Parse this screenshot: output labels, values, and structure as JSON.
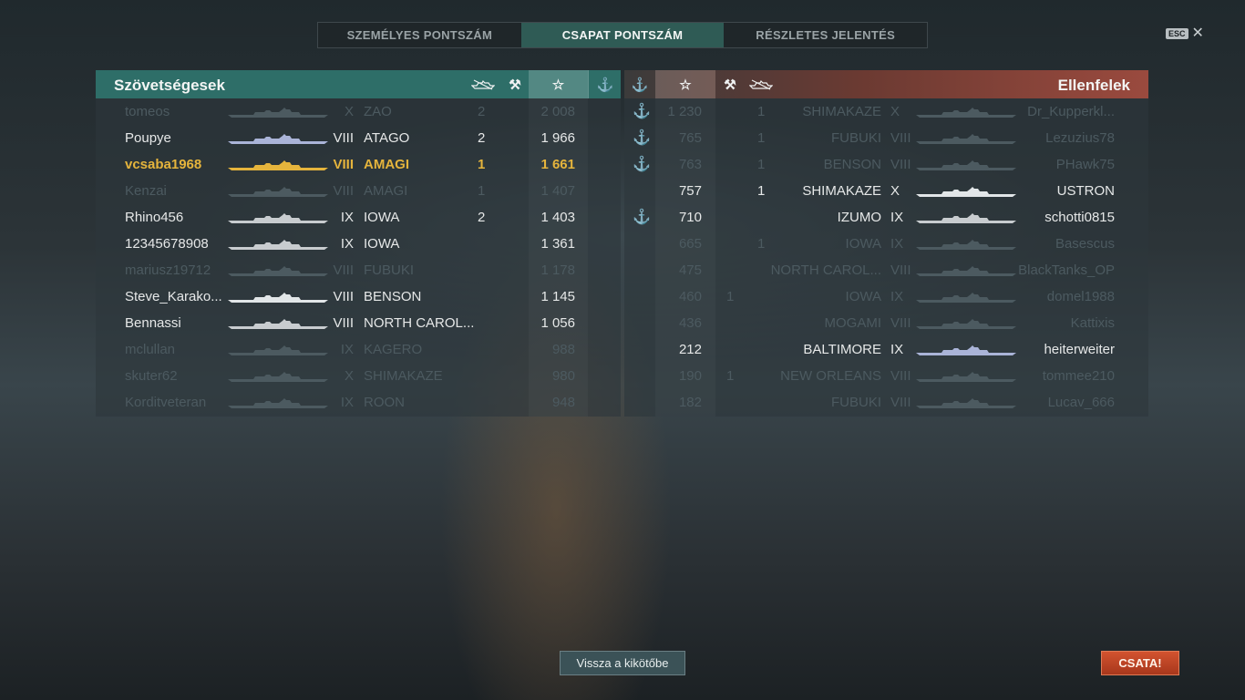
{
  "tabs": [
    "SZEMÉLYES PONTSZÁM",
    "CSAPAT PONTSZÁM",
    "RÉSZLETES JELENTÉS"
  ],
  "active_tab": 1,
  "esc_label": "ESC",
  "left": {
    "title": "Szövetségesek",
    "header_icons": [
      "ship-destroyed-icon",
      "crossed-tools-icon",
      "star-icon",
      "anchor-icon"
    ],
    "players": [
      {
        "name": "tomeos",
        "tier": "X",
        "ship": "ZAO",
        "kills": "2",
        "score": "2 008",
        "state": "dim",
        "ship_color": "#4c5a60"
      },
      {
        "name": "Poupye",
        "tier": "VIII",
        "ship": "ATAGO",
        "kills": "2",
        "score": "1 966",
        "state": "normal",
        "ship_color": "#aab4d8"
      },
      {
        "name": "vcsaba1968",
        "tier": "VIII",
        "ship": "AMAGI",
        "kills": "1",
        "score": "1 661",
        "state": "hl",
        "ship_color": "#e5b43c"
      },
      {
        "name": "Kenzai",
        "tier": "VIII",
        "ship": "AMAGI",
        "kills": "1",
        "score": "1 407",
        "state": "dim",
        "ship_color": "#4c5a60"
      },
      {
        "name": "Rhino456",
        "tier": "IX",
        "ship": "IOWA",
        "kills": "2",
        "score": "1 403",
        "state": "normal",
        "ship_color": "#c8cccf"
      },
      {
        "name": "12345678908",
        "tier": "IX",
        "ship": "IOWA",
        "kills": "",
        "score": "1 361",
        "state": "normal",
        "ship_color": "#c8cccf"
      },
      {
        "name": "mariusz19712",
        "tier": "VIII",
        "ship": "FUBUKI",
        "kills": "",
        "score": "1 178",
        "state": "dim",
        "ship_color": "#4c5a60"
      },
      {
        "name": "Steve_Karako...",
        "tier": "VIII",
        "ship": "BENSON",
        "kills": "",
        "score": "1 145",
        "state": "normal",
        "ship_color": "#e2e6e8"
      },
      {
        "name": "Bennassi",
        "tier": "VIII",
        "ship": "NORTH CAROL...",
        "kills": "",
        "score": "1 056",
        "state": "normal",
        "ship_color": "#c8cccf"
      },
      {
        "name": "mclullan",
        "tier": "IX",
        "ship": "KAGERO",
        "kills": "",
        "score": "988",
        "state": "dim",
        "ship_color": "#4c5a60"
      },
      {
        "name": "skuter62",
        "tier": "X",
        "ship": "SHIMAKAZE",
        "kills": "",
        "score": "980",
        "state": "dim",
        "ship_color": "#4c5a60"
      },
      {
        "name": "Korditveteran",
        "tier": "IX",
        "ship": "ROON",
        "kills": "",
        "score": "948",
        "state": "dim",
        "ship_color": "#4c5a60"
      }
    ]
  },
  "right": {
    "title": "Ellenfelek",
    "header_icons": [
      "anchor-icon",
      "star-icon",
      "crossed-tools-icon",
      "ship-destroyed-icon"
    ],
    "players": [
      {
        "anchor": true,
        "score": "1 230",
        "c1": "",
        "kills": "1",
        "ship": "SHIMAKAZE",
        "tier": "X",
        "name": "Dr_Kupperkl...",
        "state": "dim",
        "ship_color": "#4c5a60"
      },
      {
        "anchor": true,
        "score": "765",
        "c1": "",
        "kills": "1",
        "ship": "FUBUKI",
        "tier": "VIII",
        "name": "Lezuzius78",
        "state": "dim",
        "ship_color": "#4c5a60"
      },
      {
        "anchor": true,
        "score": "763",
        "c1": "",
        "kills": "1",
        "ship": "BENSON",
        "tier": "VIII",
        "name": "PHawk75",
        "state": "dim",
        "ship_color": "#4c5a60"
      },
      {
        "anchor": false,
        "score": "757",
        "c1": "",
        "kills": "1",
        "ship": "SHIMAKAZE",
        "tier": "X",
        "name": "USTRON",
        "state": "normal",
        "ship_color": "#e2e6e8"
      },
      {
        "anchor": true,
        "score": "710",
        "c1": "",
        "kills": "",
        "ship": "IZUMO",
        "tier": "IX",
        "name": "schotti0815",
        "state": "normal",
        "ship_color": "#c8cccf"
      },
      {
        "anchor": false,
        "score": "665",
        "c1": "",
        "kills": "1",
        "ship": "IOWA",
        "tier": "IX",
        "name": "Basescus",
        "state": "dim",
        "ship_color": "#4c5a60"
      },
      {
        "anchor": false,
        "score": "475",
        "c1": "",
        "kills": "",
        "ship": "NORTH CAROL...",
        "tier": "VIII",
        "name": "BlackTanks_OP",
        "state": "dim",
        "ship_color": "#4c5a60"
      },
      {
        "anchor": false,
        "score": "460",
        "c1": "1",
        "kills": "",
        "ship": "IOWA",
        "tier": "IX",
        "name": "domel1988",
        "state": "dim",
        "ship_color": "#4c5a60"
      },
      {
        "anchor": false,
        "score": "436",
        "c1": "",
        "kills": "",
        "ship": "MOGAMI",
        "tier": "VIII",
        "name": "Kattixis",
        "state": "dim",
        "ship_color": "#4c5a60"
      },
      {
        "anchor": false,
        "score": "212",
        "c1": "",
        "kills": "",
        "ship": "BALTIMORE",
        "tier": "IX",
        "name": "heiterweiter",
        "state": "normal",
        "ship_color": "#aab4d8"
      },
      {
        "anchor": false,
        "score": "190",
        "c1": "1",
        "kills": "",
        "ship": "NEW ORLEANS",
        "tier": "VIII",
        "name": "tommee210",
        "state": "dim",
        "ship_color": "#4c5a60"
      },
      {
        "anchor": false,
        "score": "182",
        "c1": "",
        "kills": "",
        "ship": "FUBUKI",
        "tier": "VIII",
        "name": "Lucav_666",
        "state": "dim",
        "ship_color": "#4c5a60"
      }
    ]
  },
  "buttons": {
    "back": "Vissza a kikötőbe",
    "battle": "CSATA!"
  }
}
